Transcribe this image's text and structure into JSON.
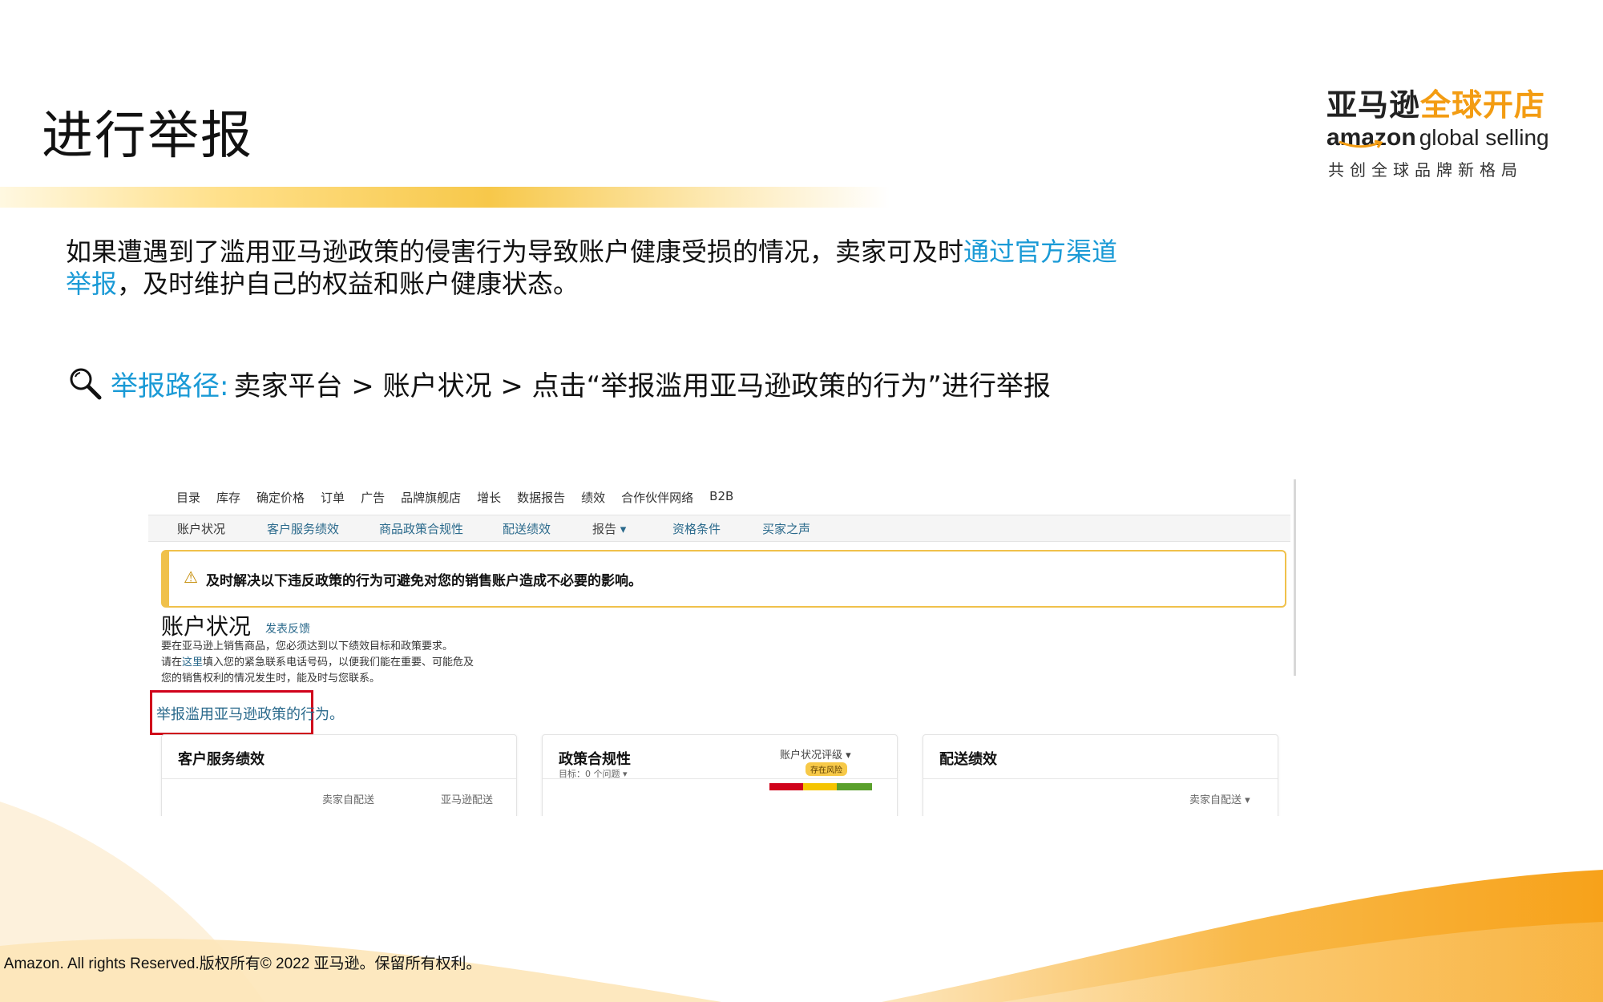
{
  "slide": {
    "title": "进行举报"
  },
  "brand": {
    "cn_part1": "亚马逊",
    "cn_part2": "全球开店",
    "en_amazon": "amazon",
    "en_global_selling": "global selling",
    "tagline": "共创全球品牌新格局",
    "accent_color": "#f39c12"
  },
  "intro": {
    "text_before": "如果遭遇到了滥用亚马逊政策的侵害行为导致账户健康受损的情况，卖家可及时",
    "highlight": "通过官方渠道举报",
    "text_after": "，及时维护自己的权益和账户健康状态。",
    "highlight_color": "#1a9ad6"
  },
  "report_path": {
    "icon": "magnifier-icon",
    "label": "举报路径:",
    "text": "卖家平台 > 账户状况 > 点击“举报滥用亚马逊政策的行为”进行举报"
  },
  "screenshot": {
    "top_nav": [
      "目录",
      "库存",
      "确定价格",
      "订单",
      "广告",
      "品牌旗舰店",
      "增长",
      "数据报告",
      "绩效",
      "合作伙伴网络",
      "B2B"
    ],
    "sub_nav": [
      "账户状况",
      "客户服务绩效",
      "商品政策合规性",
      "配送绩效",
      "报告",
      "资格条件",
      "买家之声"
    ],
    "alert": {
      "icon": "warning-icon",
      "text": "及时解决以下违反政策的行为可避免对您的销售账户造成不必要的影响。"
    },
    "account": {
      "title": "账户状况",
      "feedback": "发表反馈",
      "desc_line1": "要在亚马逊上销售商品，您必须达到以下绩效目标和政策要求。",
      "desc_line2_before": "请在",
      "desc_line2_link": "这里",
      "desc_line2_after": "填入您的紧急联系电话号码，以便我们能在重要、可能危及",
      "desc_line3": "您的销售权利的情况发生时，能及时与您联系。",
      "report_link": "举报滥用亚马逊政策的行为。"
    },
    "cards": [
      {
        "title": "客户服务绩效",
        "col1": "卖家自配送",
        "col2": "亚马逊配送"
      },
      {
        "title": "政策合规性",
        "target": "目标：0 个问题",
        "rating_label": "账户状况评级",
        "risk": "存在风险"
      },
      {
        "title": "配送绩效",
        "col1": "卖家自配送"
      }
    ],
    "rating_colors": [
      "#d0021b",
      "#f5c400",
      "#5aa02c"
    ]
  },
  "footer": {
    "copyright": "2 Amazon. All rights Reserved.版权所有© 2022 亚马逊。保留所有权利。"
  }
}
